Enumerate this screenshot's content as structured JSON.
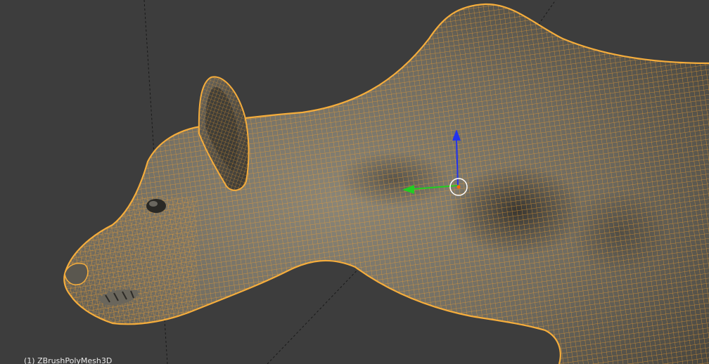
{
  "viewport": {
    "background_color": "#3d3d3d",
    "object_label": "(1) ZBrushPolyMesh3D"
  },
  "colors": {
    "wireframe": "#f0a030",
    "mesh_shade_light": "#8a8577",
    "mesh_shade_dark": "#3e3c37",
    "grid_line": "#1a1a1a",
    "gizmo_x": "#22cc22",
    "gizmo_z": "#2233ee",
    "gizmo_center": "#ffffff"
  },
  "gizmo": {
    "type": "translate-manipulator",
    "axes": [
      "x",
      "z"
    ]
  }
}
